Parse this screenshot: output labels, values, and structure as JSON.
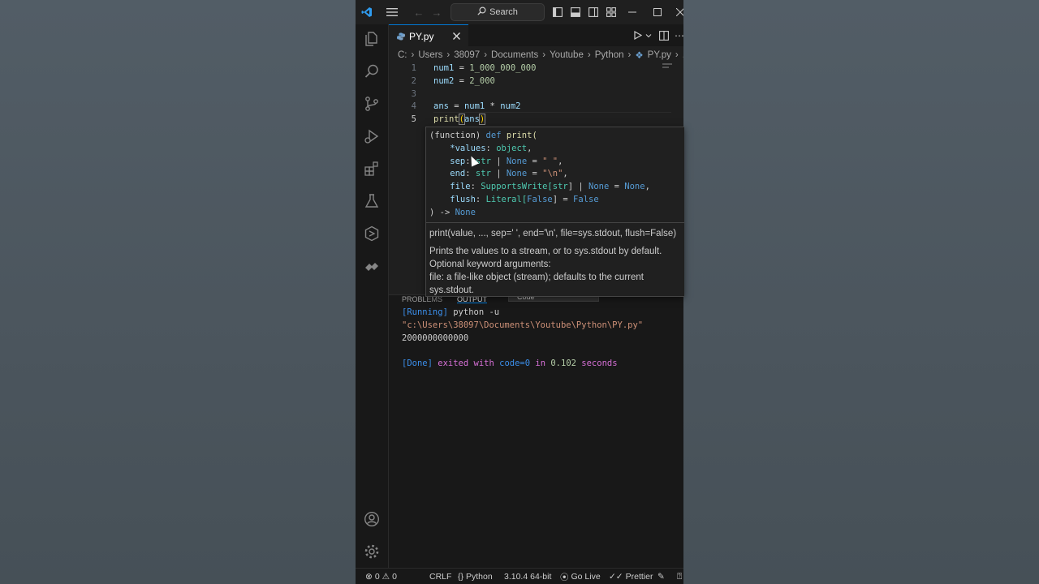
{
  "titlebar": {
    "search": "Search"
  },
  "tab": {
    "filename": "PY.py"
  },
  "breadcrumb": [
    "C:",
    "Users",
    "38097",
    "Documents",
    "Youtube",
    "Python",
    "PY.py",
    "..."
  ],
  "editor": {
    "line_numbers": [
      "1",
      "2",
      "3",
      "4",
      "5"
    ],
    "line1": {
      "a": "num1",
      "b": " = ",
      "c": "1_000_000_000"
    },
    "line2": {
      "a": "num2",
      "b": " = ",
      "c": "2_000"
    },
    "line4": {
      "a": "ans",
      "b": " = ",
      "c": "num1",
      "d": " * ",
      "e": "num2"
    },
    "line5": {
      "a": "print",
      "b": "(",
      "c": "ans",
      "d": ")"
    }
  },
  "hover": {
    "sig": {
      "l1a": "(function) ",
      "l1b": "def",
      "l1c": " print(",
      "l2a": "    *values",
      "l2b": ": ",
      "l2c": "object",
      "l2d": ",",
      "l3a": "    sep",
      "l3b": ": ",
      "l3c": "str",
      "l3d": " | ",
      "l3e": "None",
      "l3f": " = ",
      "l3g": "\" \"",
      "l3h": ",",
      "l4a": "    end",
      "l4b": ": ",
      "l4c": "str",
      "l4d": " | ",
      "l4e": "None",
      "l4f": " = ",
      "l4g": "\"\\n\"",
      "l4h": ",",
      "l5a": "    file",
      "l5b": ": ",
      "l5c": "SupportsWrite[",
      "l5d": "str",
      "l5e": "] | ",
      "l5f": "None",
      "l5g": " = ",
      "l5h": "None",
      "l5i": ",",
      "l6a": "    flush",
      "l6b": ": ",
      "l6c": "Literal[",
      "l6d": "False",
      "l6e": "] = ",
      "l6f": "False",
      "l7a": ") -> ",
      "l7b": "None"
    },
    "doc": {
      "usage": "print(value, ..., sep=' ', end='\\n', file=sys.stdout, flush=False)",
      "desc1": "Prints the values to a stream, or to sys.stdout by default.",
      "desc2": "Optional keyword arguments:",
      "desc3": "file: a file-like object (stream); defaults to the current",
      "desc4": "sys.stdout."
    }
  },
  "panel": {
    "tabs": [
      "PROBLEMS",
      "OUTPUT"
    ],
    "output_channel": "Code",
    "out": {
      "running": "[Running]",
      "cmd": " python -u",
      "path": "\"c:\\Users\\38097\\Documents\\Youtube\\Python\\PY.py\"",
      "result": "2000000000000",
      "done": "[Done]",
      "exited": " exited with ",
      "code": "code=0",
      "in": " in ",
      "secs": "0.102",
      "seconds": " seconds"
    }
  },
  "status": {
    "errors": "0",
    "warnings": "0",
    "eol": "CRLF",
    "lang": "Python",
    "version": "3.10.4 64-bit",
    "golive": "Go Live",
    "prettier": "Prettier"
  },
  "icons": [
    "vscode-logo-icon",
    "menu-icon",
    "back-arrow-icon",
    "forward-arrow-icon",
    "search-icon",
    "toggle-sidebar-icon",
    "toggle-panel-icon",
    "toggle-secondary-sidebar-icon",
    "customize-layout-icon",
    "minimize-icon",
    "maximize-icon",
    "close-window-icon",
    "explorer-icon",
    "search-view-icon",
    "source-control-icon",
    "run-debug-icon",
    "extensions-icon",
    "testing-icon",
    "remote-explorer-icon",
    "live-share-icon",
    "accounts-icon",
    "manage-gear-icon",
    "python-file-icon",
    "tab-close-icon",
    "run-icon",
    "split-editor-icon",
    "more-actions-icon"
  ],
  "colors": {
    "accent": "#0078d4",
    "keyword": "#569cd6",
    "variable": "#9cdcfe",
    "number": "#b5cea8",
    "function": "#dcdcaa",
    "type": "#4ec9b0",
    "string": "#ce9178"
  }
}
